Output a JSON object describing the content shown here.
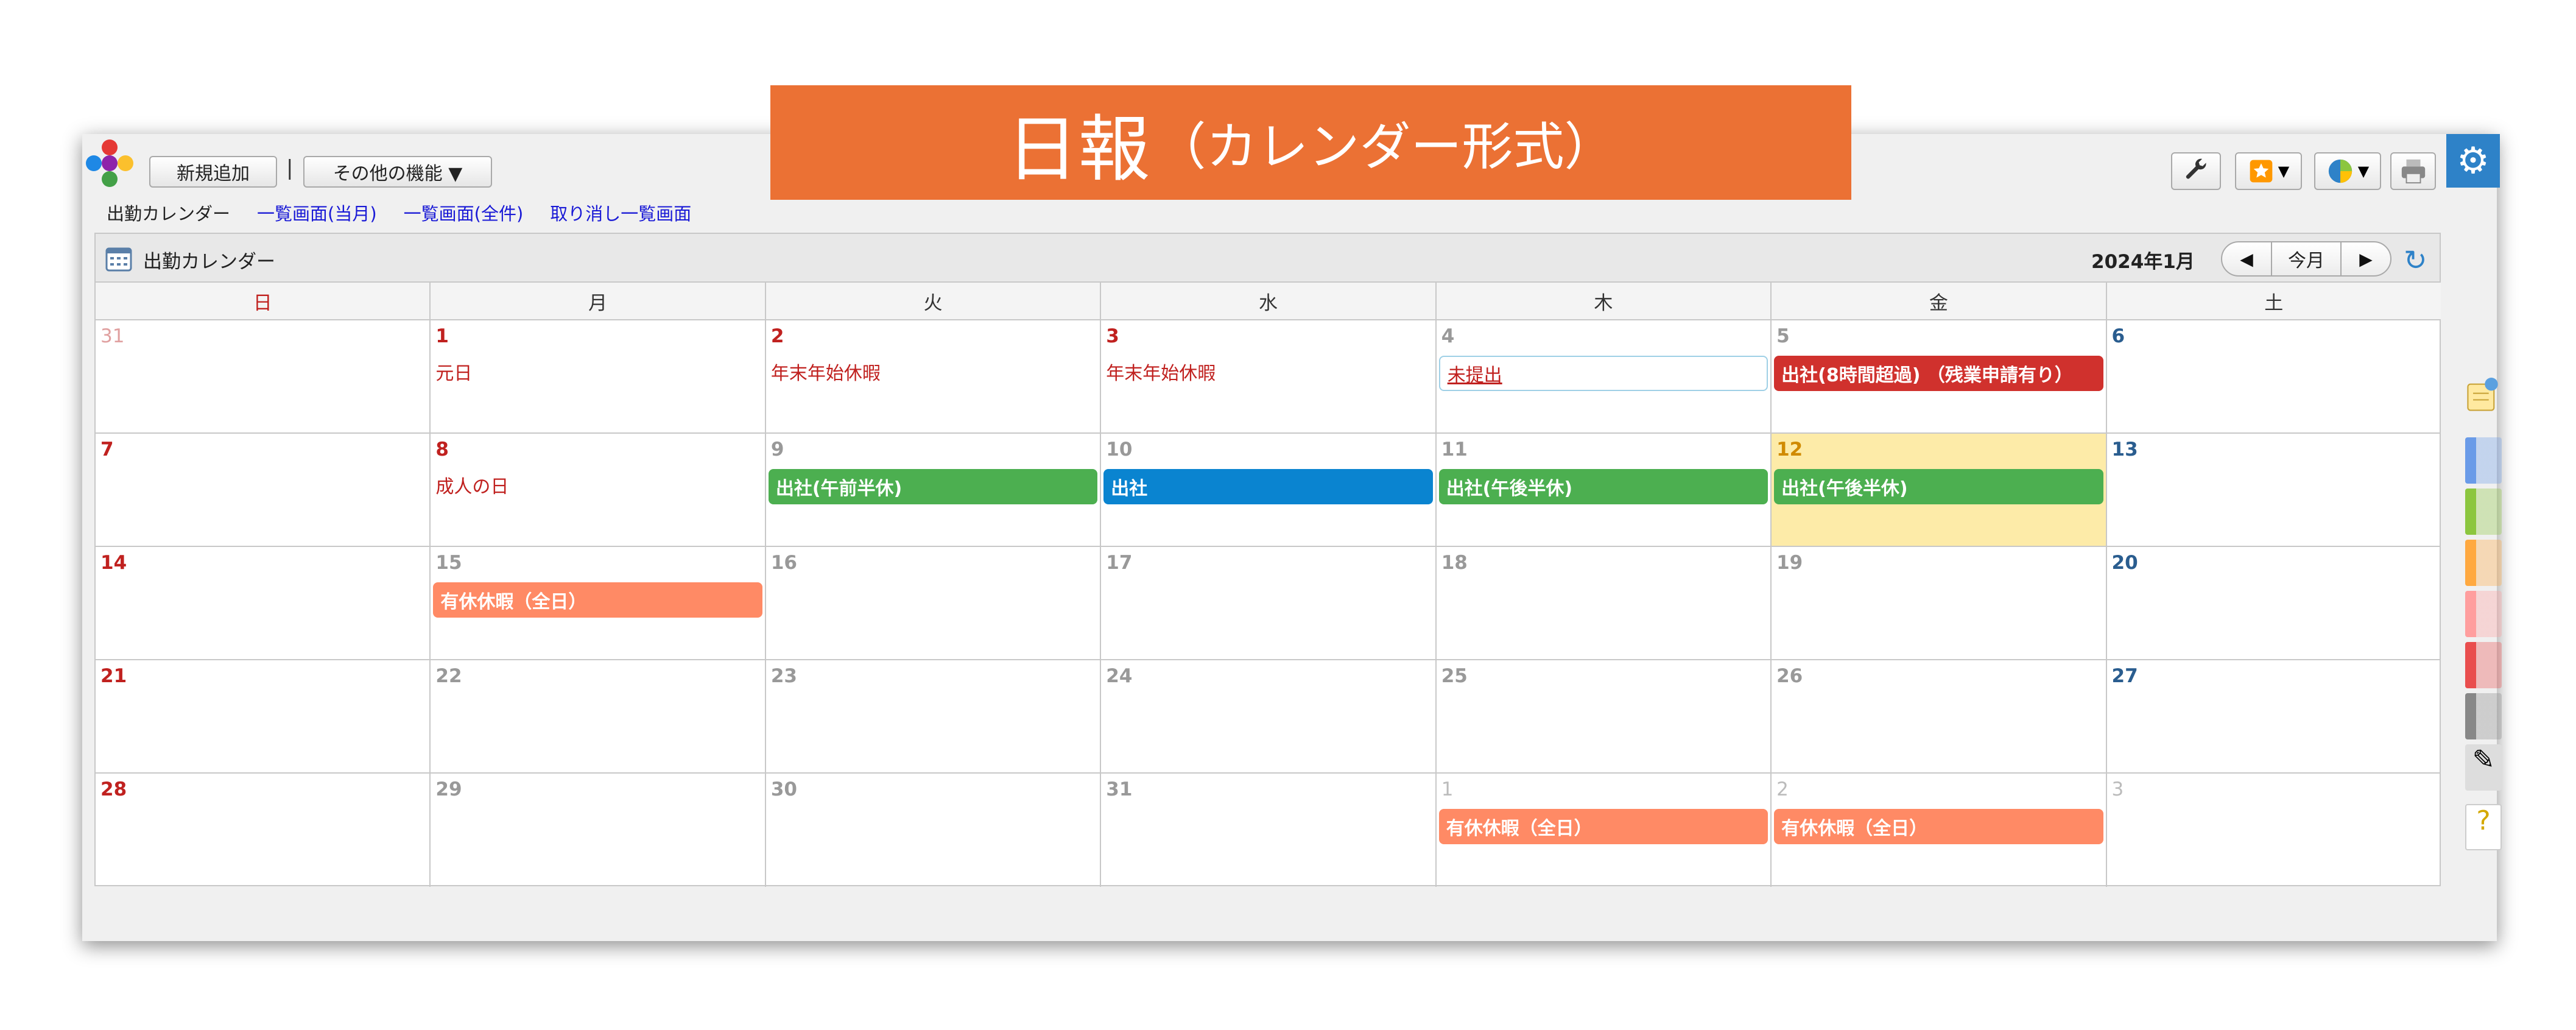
{
  "banner": {
    "title": "日報",
    "subtitle": "（カレンダー形式）"
  },
  "toolbar": {
    "new_label": "新規追加",
    "separator": "|",
    "more_label": "その他の機能 ▼"
  },
  "tabs": [
    {
      "label": "出勤カレンダー",
      "current": true
    },
    {
      "label": "一覧画面(当月)",
      "current": false
    },
    {
      "label": "一覧画面(全件)",
      "current": false
    },
    {
      "label": "取り消し一覧画面",
      "current": false
    }
  ],
  "calendar": {
    "title": "出勤カレンダー",
    "month": "2024年1月",
    "today_label": "今月",
    "weekdays": [
      "日",
      "月",
      "火",
      "水",
      "木",
      "金",
      "土"
    ],
    "weeks": [
      [
        {
          "day": "31",
          "cls": "other sun"
        },
        {
          "day": "1",
          "cls": "hol",
          "holiday": "元日"
        },
        {
          "day": "2",
          "cls": "hol",
          "holiday": "年末年始休暇"
        },
        {
          "day": "3",
          "cls": "hol",
          "holiday": "年末年始休暇"
        },
        {
          "day": "4",
          "cls": "",
          "event": "未提出",
          "event_color": "outline"
        },
        {
          "day": "5",
          "cls": "",
          "event": "出社(8時間超過) （残業申請有り）",
          "event_color": "#d0312d"
        },
        {
          "day": "6",
          "cls": "sat"
        }
      ],
      [
        {
          "day": "7",
          "cls": "sun"
        },
        {
          "day": "8",
          "cls": "hol",
          "holiday": "成人の日"
        },
        {
          "day": "9",
          "cls": "",
          "event": "出社(午前半休)",
          "event_color": "#4caf50"
        },
        {
          "day": "10",
          "cls": "",
          "event": "出社",
          "event_color": "#0a84d0"
        },
        {
          "day": "11",
          "cls": "",
          "event": "出社(午後半休)",
          "event_color": "#4caf50"
        },
        {
          "day": "12",
          "cls": "tod",
          "today": true,
          "event": "出社(午後半休)",
          "event_color": "#4caf50"
        },
        {
          "day": "13",
          "cls": "sat"
        }
      ],
      [
        {
          "day": "14",
          "cls": "sun"
        },
        {
          "day": "15",
          "cls": "",
          "event": "有休休暇（全日）",
          "event_color": "#ff8a65"
        },
        {
          "day": "16",
          "cls": ""
        },
        {
          "day": "17",
          "cls": ""
        },
        {
          "day": "18",
          "cls": ""
        },
        {
          "day": "19",
          "cls": ""
        },
        {
          "day": "20",
          "cls": "sat"
        }
      ],
      [
        {
          "day": "21",
          "cls": "sun"
        },
        {
          "day": "22",
          "cls": ""
        },
        {
          "day": "23",
          "cls": ""
        },
        {
          "day": "24",
          "cls": ""
        },
        {
          "day": "25",
          "cls": ""
        },
        {
          "day": "26",
          "cls": ""
        },
        {
          "day": "27",
          "cls": "sat"
        }
      ],
      [
        {
          "day": "28",
          "cls": "sun"
        },
        {
          "day": "29",
          "cls": ""
        },
        {
          "day": "30",
          "cls": ""
        },
        {
          "day": "31",
          "cls": ""
        },
        {
          "day": "1",
          "cls": "other",
          "event": "有休休暇（全日）",
          "event_color": "#ff8a65"
        },
        {
          "day": "2",
          "cls": "other",
          "event": "有休休暇（全日）",
          "event_color": "#ff8a65"
        },
        {
          "day": "3",
          "cls": "other"
        }
      ]
    ]
  },
  "sidebar_colors": [
    "#6a9be8",
    "#8cc63f",
    "#ffa940",
    "#ff9e9e",
    "#e94e4e",
    "#888888"
  ],
  "icons": {
    "settings": "wrench-icon",
    "favorites": "star-icon",
    "chart": "pie-chart-icon",
    "print": "printer-icon",
    "gear": "gear-icon",
    "refresh": "refresh-icon",
    "prev": "triangle-left-icon",
    "next": "triangle-right-icon"
  }
}
